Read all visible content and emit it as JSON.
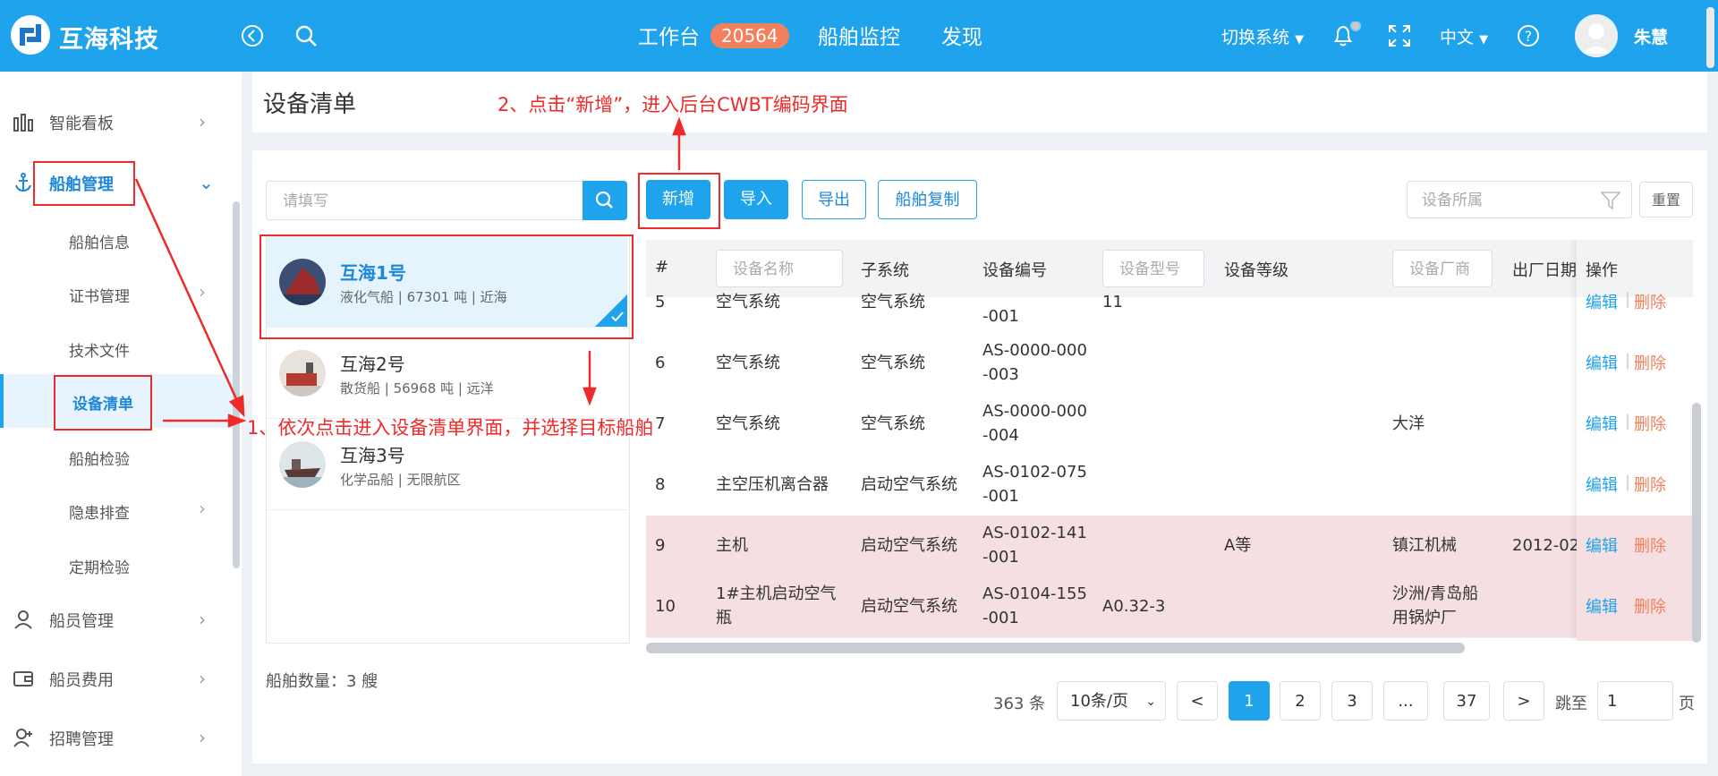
{
  "header": {
    "logo_text": "互海科技",
    "nav": [
      "工作台",
      "船舶监控",
      "发现"
    ],
    "badge": "20564",
    "switch_system": "切换系统",
    "language": "中文",
    "user_name": "朱慧",
    "bg_color": "#1ea3ec"
  },
  "sidebar": {
    "items": [
      {
        "label": "智能看板",
        "icon": "bar-chart-icon"
      },
      {
        "label": "船舶管理",
        "icon": "anchor-icon"
      },
      {
        "label": "船员管理",
        "icon": "user-icon"
      },
      {
        "label": "船员费用",
        "icon": "wallet-icon"
      },
      {
        "label": "招聘管理",
        "icon": "user-plus-icon"
      }
    ],
    "sub_items": [
      "船舶信息",
      "证书管理",
      "技术文件",
      "设备清单",
      "船舶检验",
      "隐患排查",
      "定期检验"
    ]
  },
  "page": {
    "title": "设备清单"
  },
  "toolbar": {
    "search_placeholder": "请填写",
    "add": "新增",
    "import": "导入",
    "export": "导出",
    "copy_ship": "船舶复制",
    "filter_placeholder": "设备所属",
    "reset": "重置"
  },
  "ships": [
    {
      "name": "互海1号",
      "desc": "液化气船 | 67301 吨 | 近海"
    },
    {
      "name": "互海2号",
      "desc": "散货船 | 56968 吨 | 远洋"
    },
    {
      "name": "互海3号",
      "desc": "化学品船 | 无限航区"
    }
  ],
  "ship_count": "船舶数量：3 艘",
  "table": {
    "headers": {
      "index": "#",
      "name": "设备名称",
      "subsystem": "子系统",
      "code": "设备编号",
      "model": "设备型号",
      "grade": "设备等级",
      "maker": "设备厂商",
      "date": "出厂日期",
      "op": "操作"
    },
    "rows": [
      {
        "index": "5",
        "name": "空气系统",
        "subsystem": "空气系统",
        "code1": "",
        "code2": "-001",
        "model": "11",
        "grade": "",
        "maker1": "",
        "maker2": "",
        "date": ""
      },
      {
        "index": "6",
        "name": "空气系统",
        "subsystem": "空气系统",
        "code1": "AS-0000-000",
        "code2": "-003",
        "model": "",
        "grade": "",
        "maker1": "",
        "maker2": "",
        "date": ""
      },
      {
        "index": "7",
        "name": "空气系统",
        "subsystem": "空气系统",
        "code1": "AS-0000-000",
        "code2": "-004",
        "model": "",
        "grade": "",
        "maker1": "大洋",
        "maker2": "",
        "date": ""
      },
      {
        "index": "8",
        "name": "主空压机离合器",
        "subsystem": "启动空气系统",
        "code1": "AS-0102-075",
        "code2": "-001",
        "model": "",
        "grade": "",
        "maker1": "",
        "maker2": "",
        "date": ""
      },
      {
        "index": "9",
        "name": "主机",
        "subsystem": "启动空气系统",
        "code1": "AS-0102-141",
        "code2": "-001",
        "model": "",
        "grade": "A等",
        "maker1": "镇江机械",
        "maker2": "",
        "date": "2012-02"
      },
      {
        "index": "10",
        "name": "1#主机启动空气瓶",
        "subsystem": "启动空气系统",
        "code1": "AS-0104-155",
        "code2": "-001",
        "model": "A0.32-3",
        "grade": "",
        "maker1": "沙洲/青岛船",
        "maker2": "用锅炉厂",
        "date": ""
      }
    ],
    "edit": "编辑",
    "delete": "删除"
  },
  "pagination": {
    "total": "363 条",
    "page_size": "10条/页",
    "prev": "<",
    "pages": [
      "1",
      "2",
      "3",
      "...",
      "37"
    ],
    "next": ">",
    "jump_label": "跳至",
    "jump_value": "1",
    "page_suffix": "页"
  },
  "annotations": {
    "step1": "1、依次点击进入设备清单界面，并选择目标船舶",
    "step2": "2、点击“新增”，进入后台CWBT编码界面"
  }
}
